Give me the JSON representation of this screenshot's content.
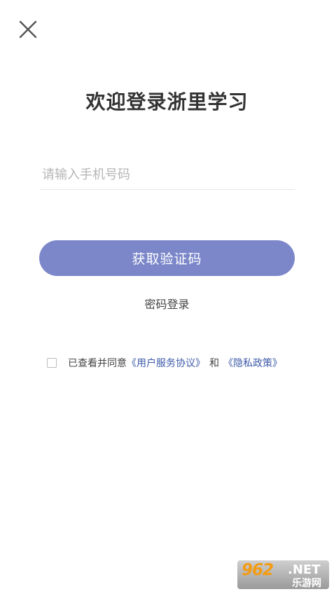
{
  "header": {
    "close_icon": "close-icon"
  },
  "title": "欢迎登录浙里学习",
  "phone": {
    "placeholder": "请输入手机号码",
    "value": ""
  },
  "get_code_button": "获取验证码",
  "password_login": "密码登录",
  "agreement": {
    "checked": false,
    "prefix": "已查看并同意",
    "user_agreement": "《用户服务协议》",
    "and": "和",
    "privacy_policy": "《隐私政策》"
  },
  "watermark": {
    "main": "962",
    "net": ".NET",
    "sub": "乐游网"
  },
  "colors": {
    "accent": "#7b87c9",
    "link": "#3d5aa8"
  }
}
